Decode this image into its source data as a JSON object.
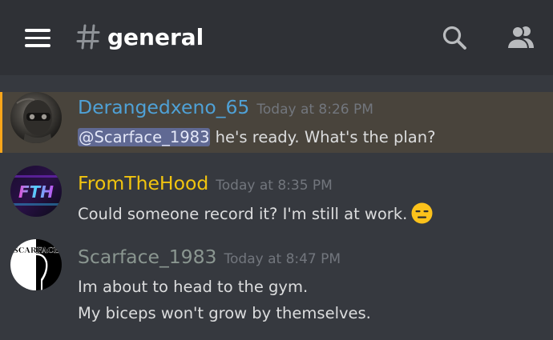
{
  "header": {
    "channel_name": "general",
    "icons": {
      "menu": "hamburger-menu-icon",
      "hash": "hash-icon",
      "search": "search-icon",
      "members": "members-icon"
    }
  },
  "colors": {
    "background": "#36393f",
    "header_background": "#2f3136",
    "mention_highlight": "#49443c",
    "mention_bar": "#faa61a",
    "mention_tag": "#7289da",
    "text": "#dcddde",
    "timestamp": "#72767d"
  },
  "messages": [
    {
      "author": "Derangedxeno_65",
      "author_color": "#4fa1d6",
      "timestamp": "Today at 8:26 PM",
      "mention": "@Scarface_1983",
      "lines": [
        " he's ready. What's the plan?"
      ],
      "highlighted": true
    },
    {
      "author": "FromTheHood",
      "author_color": "#f1c40f",
      "timestamp": "Today at 8:35 PM",
      "lines": [
        "Could someone record it? I'm still at work."
      ],
      "emoji": "expressionless-face-emoji"
    },
    {
      "author": "Scarface_1983",
      "author_color": "#8a9690",
      "timestamp": "Today at 8:47 PM",
      "lines": [
        "Im about to head to the gym.",
        "My biceps won't grow by themselves."
      ],
      "avatar_text": "SCARFACE"
    }
  ]
}
